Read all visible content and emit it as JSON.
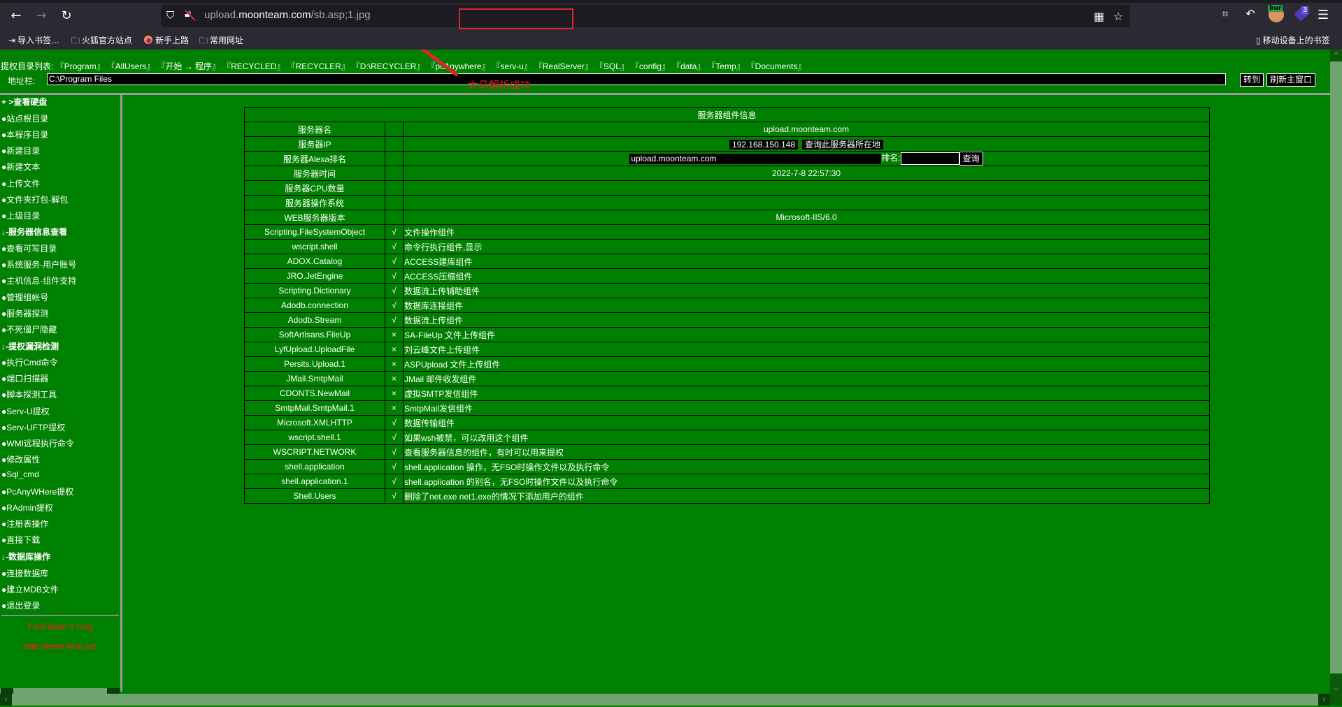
{
  "browser": {
    "url_host_prefix": "upload.",
    "url_host": "moonteam.com",
    "url_path": "/sb.asp;1.jpg",
    "bookmarks": [
      {
        "label": "导入书签...",
        "icon": "import-icon"
      },
      {
        "label": "火狐官方站点",
        "icon": "folder-icon"
      },
      {
        "label": "新手上路",
        "icon": "firefox-icon"
      },
      {
        "label": "常用网址",
        "icon": "folder-icon"
      }
    ],
    "mobile_bookmarks": "移动设备上的书签",
    "extension_badge": "3",
    "burp_label": "bur"
  },
  "annotation": {
    "text": "大马解析成功",
    "color": "#e0242c"
  },
  "toolbar": {
    "dir_list_label": "提权目录列表:",
    "dir_links": [
      "『Program』",
      "『AllUsers』",
      "『开始 → 程序』",
      "『RECYCLED』",
      "『RECYCLER』",
      "『D:\\RECYCLER』",
      "『pcAnywhere』",
      "『serv-u』",
      "『RealServer』",
      "『SQL』",
      "『config』",
      "『data』",
      "『Temp』",
      "『Documents』"
    ],
    "address_label": "地址栏:",
    "address_value": "C:\\Program Files",
    "goto_button": "转到",
    "refresh_button": "刷新主窗口"
  },
  "sidebar": {
    "items": [
      {
        "label": "+ >查看硬盘",
        "header": true
      },
      {
        "label": "●站点根目录"
      },
      {
        "label": "●本程序目录"
      },
      {
        "label": "●新建目录"
      },
      {
        "label": "●新建文本"
      },
      {
        "label": "●上传文件"
      },
      {
        "label": "●文件夹打包-解包"
      },
      {
        "label": "●上级目录"
      },
      {
        "label": "↓-服务器信息查看",
        "header": true
      },
      {
        "label": "●查看可写目录"
      },
      {
        "label": "●系统服务-用户账号"
      },
      {
        "label": "●主机信息-组件支持"
      },
      {
        "label": "●管理组帐号"
      },
      {
        "label": "●服务器探测"
      },
      {
        "label": "●不死僵尸隐藏"
      },
      {
        "label": "↓-提权漏洞检测",
        "header": true
      },
      {
        "label": "●执行Cmd命令"
      },
      {
        "label": "●端口扫描器"
      },
      {
        "label": "●脚本探测工具"
      },
      {
        "label": "●Serv-U提权"
      },
      {
        "label": "●Serv-UFTP提权"
      },
      {
        "label": "●WMI远程执行命令"
      },
      {
        "label": "●修改属性"
      },
      {
        "label": "●Sql_cmd"
      },
      {
        "label": "●PcAnyWHere提权"
      },
      {
        "label": "●RAdmin提权"
      },
      {
        "label": "●注册表操作"
      },
      {
        "label": "●直接下载"
      },
      {
        "label": "↓-数据库操作",
        "header": true
      },
      {
        "label": "●连接数据库"
      },
      {
        "label": "●建立MDB文件"
      },
      {
        "label": "●退出登录"
      }
    ],
    "blog_title": "F4ckTeam 's blog",
    "blog_url": "http://team.f4ck.net"
  },
  "server_info": {
    "title": "服务器组件信息",
    "name_label": "服务器名",
    "name_value": "upload.moonteam.com",
    "ip_label": "服务器IP",
    "ip_value": "192.168.150.148",
    "ip_lookup_link": "查询此服务器所在地",
    "alexa_label": "服务器Alexa排名",
    "alexa_domain": "upload.moonteam.com",
    "alexa_rank_label": "排名:",
    "alexa_rank_value": "",
    "alexa_query_button": "查询",
    "time_label": "服务器时间",
    "time_value": "2022-7-8 22:57:30",
    "cpu_label": "服务器CPU数量",
    "cpu_value": "",
    "os_label": "服务器操作系统",
    "os_value": "",
    "web_label": "WEB服务器版本",
    "web_value": "Microsoft-IIS/6.0"
  },
  "components": [
    {
      "name": "Scripting.FileSystemObject",
      "supported": true,
      "desc": "文件操作组件"
    },
    {
      "name": "wscript.shell",
      "supported": true,
      "desc": "命令行执行组件,显示"
    },
    {
      "name": "ADOX.Catalog",
      "supported": true,
      "desc": "ACCESS建库组件"
    },
    {
      "name": "JRO.JetEngine",
      "supported": true,
      "desc": "ACCESS压缩组件"
    },
    {
      "name": "Scripting.Dictionary",
      "supported": true,
      "desc": "数据流上传辅助组件"
    },
    {
      "name": "Adodb.connection",
      "supported": true,
      "desc": "数据库连接组件"
    },
    {
      "name": "Adodb.Stream",
      "supported": true,
      "desc": "数据流上传组件"
    },
    {
      "name": "SoftArtisans.FileUp",
      "supported": false,
      "desc": "SA-FileUp 文件上传组件"
    },
    {
      "name": "LyfUpload.UploadFile",
      "supported": false,
      "desc": "刘云峰文件上传组件"
    },
    {
      "name": "Persits.Upload.1",
      "supported": false,
      "desc": "ASPUpload 文件上传组件"
    },
    {
      "name": "JMail.SmtpMail",
      "supported": false,
      "desc": "JMail 邮件收发组件"
    },
    {
      "name": "CDONTS.NewMail",
      "supported": false,
      "desc": "虚拟SMTP发信组件"
    },
    {
      "name": "SmtpMail.SmtpMail.1",
      "supported": false,
      "desc": "SmtpMail发信组件"
    },
    {
      "name": "Microsoft.XMLHTTP",
      "supported": true,
      "desc": "数据传输组件"
    },
    {
      "name": "wscript.shell.1",
      "supported": true,
      "desc": "如果wsh被禁，可以改用这个组件"
    },
    {
      "name": "WSCRIPT.NETWORK",
      "supported": true,
      "desc": "查看服务器信息的组件，有时可以用来提权"
    },
    {
      "name": "shell.application",
      "supported": true,
      "desc": "shell.application 操作，无FSO时操作文件以及执行命令"
    },
    {
      "name": "shell.application.1",
      "supported": true,
      "desc": "shell.application 的别名，无FSO时操作文件以及执行命令"
    },
    {
      "name": "Shell.Users",
      "supported": true,
      "desc": "删除了net.exe net1.exe的情况下添加用户的组件"
    }
  ],
  "symbols": {
    "supported": "√",
    "unsupported": "×"
  },
  "colors": {
    "page_bg": "#008000",
    "unsupported": "#ff1a1a",
    "blog": "#ff1a1a"
  }
}
